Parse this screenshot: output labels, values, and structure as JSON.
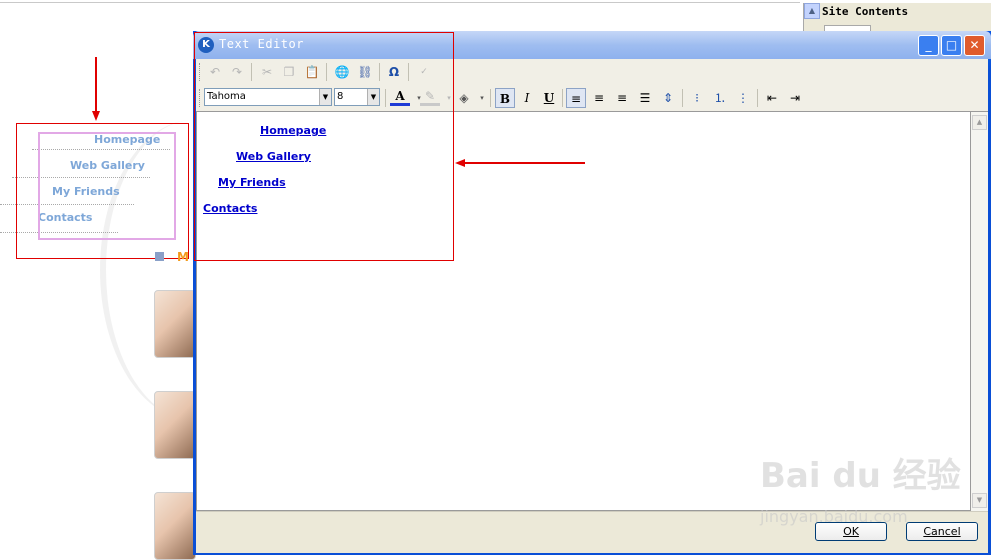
{
  "background_page": {
    "nav_items": [
      "Homepage",
      "Web Gallery",
      "My Friends",
      "Contacts"
    ],
    "section_prefix": "M"
  },
  "site_panel": {
    "title": "Site Contents"
  },
  "editor": {
    "title": "Text Editor",
    "font_family": "Tahoma",
    "font_size": "8",
    "content_links": [
      "Homepage",
      "Web Gallery",
      "My Friends",
      "Contacts"
    ],
    "ok_label": "OK",
    "cancel_label": "Cancel"
  },
  "watermark": {
    "main": "Bai du 经验",
    "sub": "jingyan.baidu.com"
  },
  "colors": {
    "annotation_red": "#e00000",
    "link_blue": "#0000cc",
    "nav_blue": "#7ea7d8",
    "title_bar": "#0a55e3"
  }
}
